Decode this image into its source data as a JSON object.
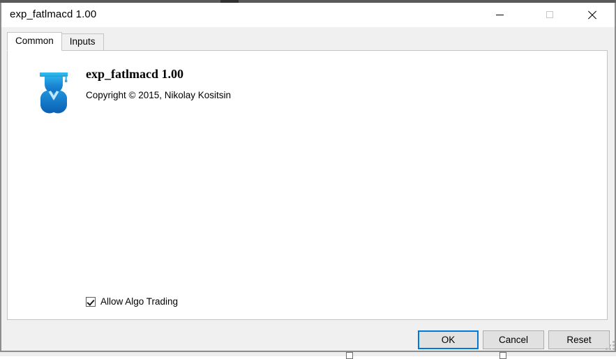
{
  "window": {
    "title": "exp_fatlmacd 1.00",
    "controls": [
      {
        "name": "minimize",
        "label": "—",
        "icon": "minimize-icon"
      },
      {
        "name": "maximize",
        "label": "□",
        "icon": "maximize-icon"
      },
      {
        "name": "close",
        "label": "✕",
        "icon": "close-icon"
      }
    ]
  },
  "tabs": [
    {
      "label": "Common",
      "active": true
    },
    {
      "label": "Inputs",
      "active": false
    }
  ],
  "common_panel": {
    "icon": "expert-advisor-graduate-icon",
    "product_title": "exp_fatlmacd 1.00",
    "copyright": "Copyright © 2015, Nikolay Kositsin",
    "algo_trading": {
      "label": "Allow Algo Trading",
      "checked": true
    }
  },
  "footer": {
    "buttons": [
      {
        "label": "OK",
        "default": true
      },
      {
        "label": "Cancel",
        "default": false
      },
      {
        "label": "Reset",
        "default": false
      }
    ]
  },
  "colors": {
    "accent": "#0078d7",
    "titlebar_bg": "#ffffff",
    "dialog_bg": "#f0f0f0",
    "panel_bg": "#ffffff",
    "button_bg": "#e1e1e1",
    "border": "#c4c4c4",
    "icon_blue_light": "#29abe2",
    "icon_blue_dark": "#0b6fc4"
  }
}
